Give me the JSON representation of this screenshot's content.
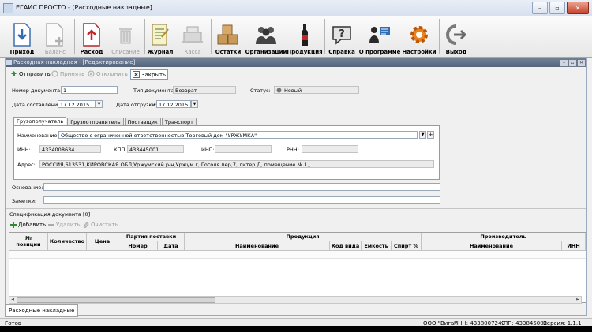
{
  "window": {
    "title": "ЕГАИС ПРОСТО - [Расходные накладные]",
    "min_glyph": "–",
    "max_glyph": "▫",
    "close_glyph": "✕"
  },
  "toolbar": {
    "income": "Приход",
    "balance": "Баланс",
    "outgo": "Расход",
    "writeoff": "Списание",
    "journal": "Журнал",
    "cashbox": "Касса",
    "remains": "Остатки",
    "organizations": "Организации",
    "products": "Продукция",
    "help": "Справка",
    "about": "О программе",
    "settings": "Настройки",
    "exit": "Выход"
  },
  "document_window": {
    "title": "Расходная накладная - [Редактирование]",
    "actions": {
      "send": "Отправить",
      "accept": "Принять",
      "reject": "Отклонить",
      "close": "Закрыть"
    }
  },
  "form": {
    "doc_number_label": "Номер документа:",
    "doc_number_value": "1",
    "doc_type_label": "Тип документа:",
    "doc_type_value": "Возврат",
    "status_label": "Статус:",
    "status_value": "Новый",
    "created_label": "Дата составления:",
    "created_value": "17.12.2015",
    "shipped_label": "Дата отгрузки:",
    "shipped_value": "17.12.2015",
    "tabs": [
      "Грузополучатель",
      "Грузоотправитель",
      "Поставщик",
      "Транспорт"
    ],
    "name_label": "Наименование:",
    "name_value": "Общество с ограниченной ответственностью Торговый дом \"УРЖУМКА\"",
    "inn_label": "ИНН:",
    "inn_value": "4334008634",
    "kpp_label": "КПП:",
    "kpp_value": "433445001",
    "inp_label": "ИНП:",
    "inp_value": "",
    "rnn_label": "РНН:",
    "rnn_value": "",
    "address_label": "Адрес:",
    "address_value": "РОССИЯ,613531,КИРОВСКАЯ ОБЛ,Уржумский р-н,Уржум г,,Гоголя пер,7, литер Д, помещение № 1,,",
    "basis_label": "Основание:",
    "basis_value": "",
    "notes_label": "Заметки:",
    "notes_value": ""
  },
  "spec": {
    "title": "Спецификация документа [0]",
    "add": "Добавить",
    "delete": "Удалить",
    "clear": "Очистить",
    "headers": {
      "pos": "№ позиции",
      "qty": "Количество",
      "price": "Цена",
      "batch": "Партия поставки",
      "batch_no": "Номер",
      "batch_date": "Дата",
      "product": "Продукция",
      "product_name": "Наименование",
      "kind_code": "Код вида",
      "volume": "Емкость",
      "alcohol": "Спирт %",
      "producer": "Производитель",
      "producer_name": "Наименование",
      "producer_inn": "ИНН"
    }
  },
  "doc_tab": "Расходные накладные",
  "status": {
    "ready": "Готов",
    "org": "ООО \"Вига\"",
    "inn": "ИНН: 4338007243",
    "kpp": "КПП: 433845002",
    "version": "Версия: 1.1.1"
  }
}
